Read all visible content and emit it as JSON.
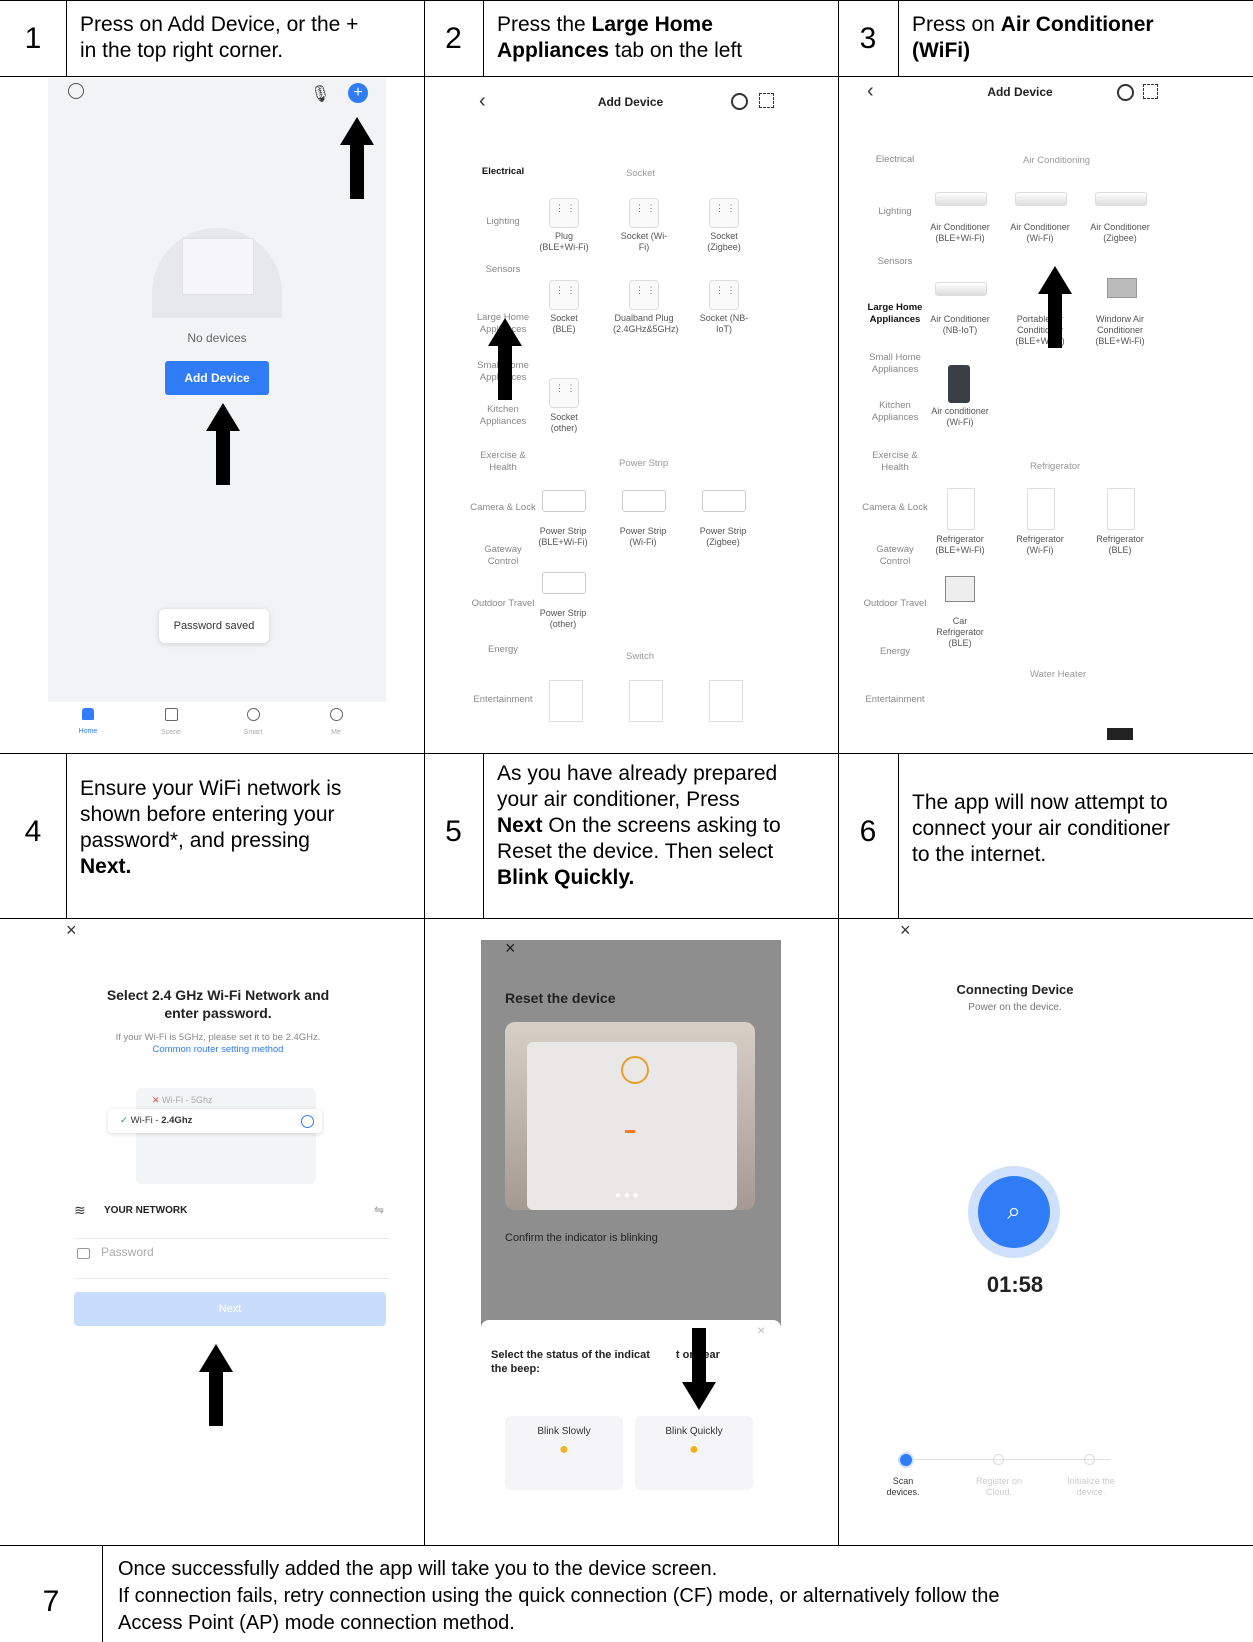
{
  "header_partial": "(… … … … … … … … … … … … … … … … … … …)",
  "steps": [
    {
      "num": "1",
      "line1": "Press on Add Device, or the +",
      "line2": "in the top right corner."
    },
    {
      "num": "2",
      "pre": "Press the ",
      "bold": "Large Home",
      "line2_bold": "Appliances",
      "line2_rest": " tab on the left"
    },
    {
      "num": "3",
      "pre": "Press on ",
      "bold": "Air Conditioner",
      "line2_bold": "(WiFi)"
    },
    {
      "num": "4",
      "line1": "Ensure your WiFi network is",
      "line2": "shown before entering your",
      "line3": "password*, and pressing",
      "line4_bold": "Next."
    },
    {
      "num": "5",
      "line1": "As you have already prepared",
      "line2": "your air conditioner, Press",
      "line3_bold": "Next",
      "line3_rest": " On the screens asking to",
      "line4": "Reset the device. Then select",
      "line5_bold": "Blink Quickly."
    },
    {
      "num": "6",
      "line1": "The app will now attempt to",
      "line2": "connect your air conditioner",
      "line3": "to the internet."
    },
    {
      "num": "7",
      "line1": "Once successfully added the app will take you to the device screen.",
      "line2": "If connection fails, retry connection using the quick connection (CF) mode, or alternatively follow the",
      "line3": "Access Point (AP) mode connection method."
    }
  ],
  "screen1": {
    "no_devices": "No devices",
    "add_device": "Add Device",
    "toast": "Password saved",
    "tabs": [
      "Home",
      "Scene",
      "Smart",
      "Me"
    ]
  },
  "screen2": {
    "title": "Add Device",
    "categories": [
      "Electrical",
      "Lighting",
      "Sensors",
      "Large Home Appliances",
      "Small Home Appliances",
      "Kitchen Appliances",
      "Exercise & Health",
      "Camera & Lock",
      "Gateway Control",
      "Outdoor Travel",
      "Energy",
      "Entertainment"
    ],
    "section_socket": "Socket",
    "section_strip": "Power Strip",
    "section_switch": "Switch",
    "items": [
      "Plug (BLE+Wi-Fi)",
      "Socket (Wi-Fi)",
      "Socket (Zigbee)",
      "Socket (BLE)",
      "Dualband Plug (2.4GHz&5GHz)",
      "Socket (NB-IoT)",
      "Socket (other)"
    ],
    "strips": [
      "Power Strip (BLE+Wi-Fi)",
      "Power Strip (Wi-Fi)",
      "Power Strip (Zigbee)",
      "Power Strip (other)"
    ]
  },
  "screen3": {
    "title": "Add Device",
    "categories": [
      "Electrical",
      "Lighting",
      "Sensors",
      "Large Home Appliances",
      "Small Home Appliances",
      "Kitchen Appliances",
      "Exercise & Health",
      "Camera & Lock",
      "Gateway Control",
      "Outdoor Travel",
      "Energy",
      "Entertainment"
    ],
    "section_ac": "Air Conditioning",
    "section_fridge": "Refrigerator",
    "section_heater": "Water Heater",
    "items": [
      "Air Conditioner (BLE+Wi-Fi)",
      "Air Conditioner (Wi-Fi)",
      "Air Conditioner (Zigbee)",
      "Air Conditioner (NB-IoT)",
      "Portable Air Conditioner (BLE+Wi-Fi)",
      "Windorw Air Conditioner (BLE+Wi-Fi)",
      "Air conditioner (Wi-Fi)"
    ],
    "fridges": [
      "Refrigerator (BLE+Wi-Fi)",
      "Refrigerator (Wi-Fi)",
      "Refrigerator (BLE)",
      "Car Refrigerator (BLE)"
    ]
  },
  "screen4": {
    "close": "×",
    "title1": "Select 2.4 GHz Wi-Fi Network and",
    "title2": "enter password.",
    "sub": "If your Wi-Fi is 5GHz, please set it to be 2.4GHz.",
    "link": "Common router setting method",
    "wifi5": "Wi-Fi - 5Ghz",
    "wifi24_pre": "Wi-Fi - ",
    "wifi24": "2.4Ghz",
    "network": "YOUR NETWORK",
    "password": "Password",
    "next": "Next"
  },
  "screen5": {
    "close": "×",
    "title": "Reset the device",
    "confirm": "Confirm the indicator is blinking",
    "select1": "Select the status of the indicat",
    "select1b": "t or hear",
    "select2": "the beep:",
    "slow": "Blink Slowly",
    "quick": "Blink Quickly"
  },
  "screen6": {
    "close": "×",
    "title": "Connecting Device",
    "sub": "Power on the device.",
    "timer": "01:58",
    "steps": [
      "Scan devices.",
      "Register on Cloud.",
      "Initialize the device."
    ]
  }
}
